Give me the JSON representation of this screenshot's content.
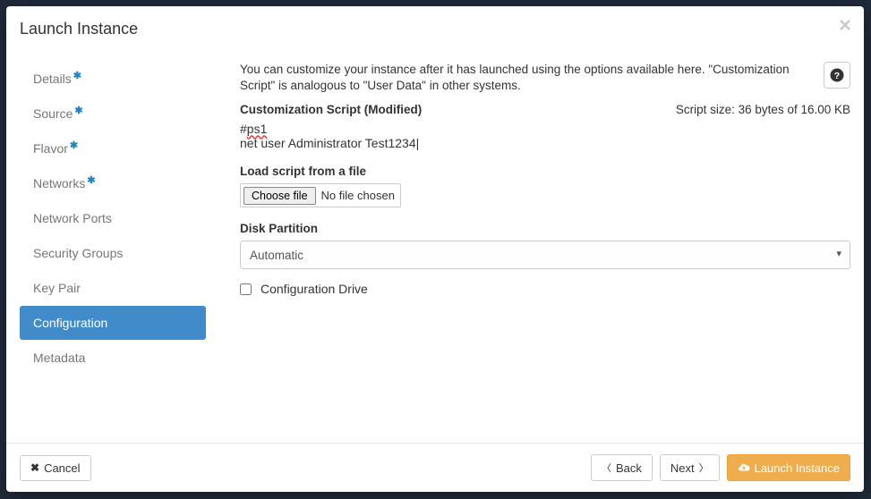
{
  "modal": {
    "title": "Launch Instance"
  },
  "sidebar": {
    "items": [
      {
        "label": "Details",
        "required": true
      },
      {
        "label": "Source",
        "required": true
      },
      {
        "label": "Flavor",
        "required": true
      },
      {
        "label": "Networks",
        "required": true
      },
      {
        "label": "Network Ports",
        "required": false
      },
      {
        "label": "Security Groups",
        "required": false
      },
      {
        "label": "Key Pair",
        "required": false
      },
      {
        "label": "Configuration",
        "required": false,
        "active": true
      },
      {
        "label": "Metadata",
        "required": false
      }
    ]
  },
  "config": {
    "intro": "You can customize your instance after it has launched using the options available here. \"Customization Script\" is analogous to \"User Data\" in other systems.",
    "script_label": "Customization Script (Modified)",
    "script_size": "Script size: 36 bytes of 16.00 KB",
    "script_line1_hash": "#",
    "script_line1_word": "ps1",
    "script_line2": "net user Administrator Test1234|",
    "load_label": "Load script from a file",
    "choose_file": "Choose file",
    "file_status": "No file chosen",
    "partition_label": "Disk Partition",
    "partition_value": "Automatic",
    "drive_label": "Configuration Drive"
  },
  "footer": {
    "cancel": "Cancel",
    "back": "Back",
    "next": "Next",
    "launch": "Launch Instance"
  }
}
